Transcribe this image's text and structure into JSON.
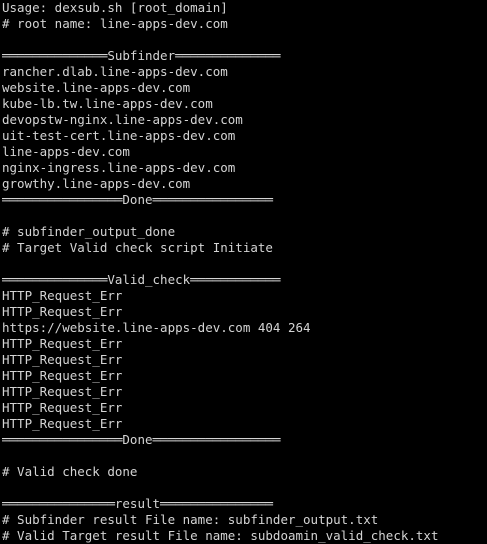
{
  "terminal": {
    "lines": [
      "Usage: dexsub.sh [root_domain]",
      "# root name: line-apps-dev.com",
      "",
      "══════════════Subfinder══════════════",
      "rancher.dlab.line-apps-dev.com",
      "website.line-apps-dev.com",
      "kube-lb.tw.line-apps-dev.com",
      "devopstw-nginx.line-apps-dev.com",
      "uit-test-cert.line-apps-dev.com",
      "line-apps-dev.com",
      "nginx-ingress.line-apps-dev.com",
      "growthy.line-apps-dev.com",
      "════════════════Done════════════════",
      "",
      "# subfinder_output_done",
      "# Target Valid check script Initiate",
      "",
      "══════════════Valid_check════════════",
      "HTTP_Request_Err",
      "HTTP_Request_Err",
      "https://website.line-apps-dev.com 404 264",
      "HTTP_Request_Err",
      "HTTP_Request_Err",
      "HTTP_Request_Err",
      "HTTP_Request_Err",
      "HTTP_Request_Err",
      "HTTP_Request_Err",
      "════════════════Done═════════════════",
      "",
      "# Valid check done",
      "",
      "═══════════════result═══════════════",
      "# Subfinder result File name: subfinder_output.txt",
      "# Valid Target result File name: subdoamin_valid_check.txt"
    ]
  }
}
